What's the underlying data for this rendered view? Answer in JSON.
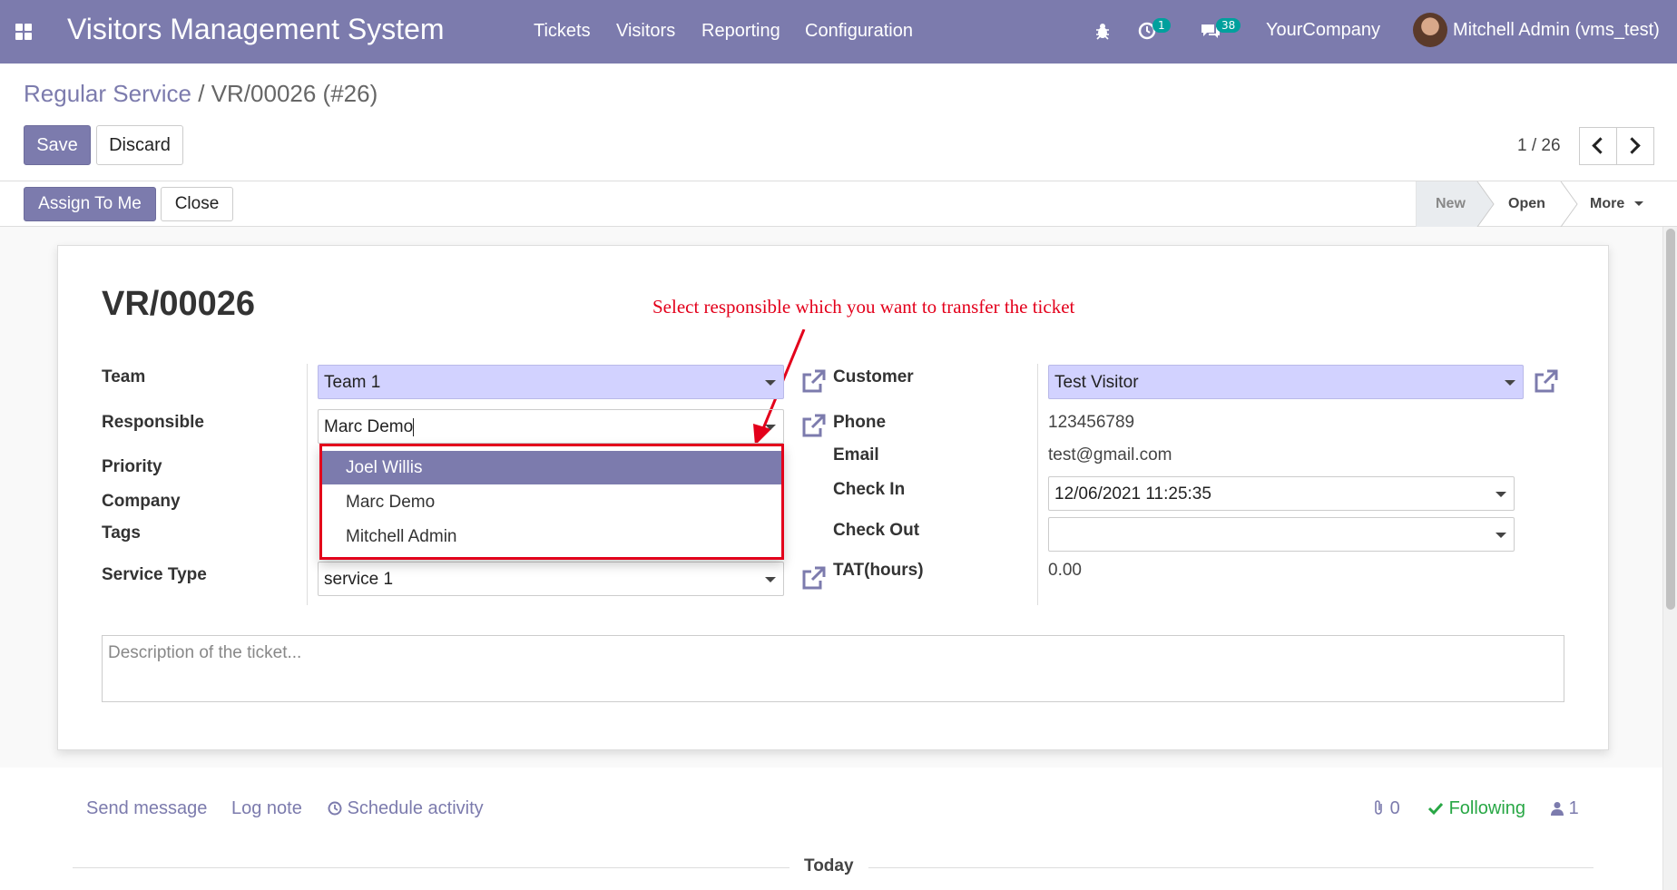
{
  "navbar": {
    "brand": "Visitors Management System",
    "menu": [
      "Tickets",
      "Visitors",
      "Reporting",
      "Configuration"
    ],
    "activity_count": "1",
    "messages_count": "38",
    "company": "YourCompany",
    "user": "Mitchell Admin (vms_test)"
  },
  "breadcrumb": {
    "parent": "Regular Service",
    "separator": "/",
    "current": "VR/00026 (#26)"
  },
  "buttons": {
    "save": "Save",
    "discard": "Discard",
    "assign": "Assign To Me",
    "close": "Close"
  },
  "pager": {
    "value": "1 / 26"
  },
  "status": {
    "stages": [
      "New",
      "Open"
    ],
    "more": "More"
  },
  "form": {
    "title": "VR/00026",
    "annotation": "Select responsible which you want to transfer the ticket",
    "labels": {
      "team": "Team",
      "responsible": "Responsible",
      "priority": "Priority",
      "company": "Company",
      "tags": "Tags",
      "service_type": "Service Type",
      "customer": "Customer",
      "phone": "Phone",
      "email": "Email",
      "check_in": "Check In",
      "check_out": "Check Out",
      "tat": "TAT(hours)"
    },
    "values": {
      "team": "Team 1",
      "responsible": "Marc Demo",
      "service_type": "service 1",
      "customer": "Test Visitor",
      "phone": "123456789",
      "email": "test@gmail.com",
      "check_in": "12/06/2021 11:25:35",
      "check_out": "",
      "tat": "0.00"
    },
    "dropdown_options": [
      "Joel Willis",
      "Marc Demo",
      "Mitchell Admin"
    ],
    "description_placeholder": "Description of the ticket..."
  },
  "chatter": {
    "send_message": "Send message",
    "log_note": "Log note",
    "schedule_activity": "Schedule activity",
    "attachments": "0",
    "following": "Following",
    "followers": "1",
    "today": "Today"
  },
  "colors": {
    "primary": "#7c7bad",
    "required_field": "#d2d2ff",
    "annotation": "#e3001b",
    "teal_badge": "#00a09d"
  }
}
